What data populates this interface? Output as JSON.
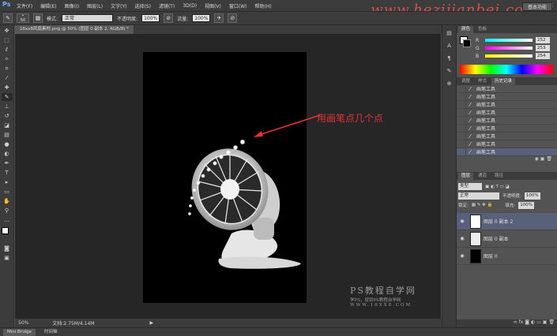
{
  "app": {
    "logo": "Ps"
  },
  "menu": [
    "文件(F)",
    "编辑(E)",
    "图像(I)",
    "图层(L)",
    "文字(Y)",
    "选择(S)",
    "滤镜(T)",
    "3D(D)",
    "视图(V)",
    "窗口(W)",
    "帮助(H)"
  ],
  "watermark": "www.hezijianbei.com",
  "options": {
    "brush_size": "50",
    "mode_label": "模式:",
    "mode_value": "正常",
    "opacity_label": "不透明度:",
    "opacity_value": "100%",
    "flow_label": "流量:",
    "flow_value": "100%",
    "workspace": "基本功能"
  },
  "document": {
    "tab_title": "16xx8风扇素材.png @ 50% (图层 0 副本 2, RGB/8) *",
    "zoom": "50%",
    "doc_size": "文档:2.75M/4.14M"
  },
  "annotation": {
    "text": "用画笔点几个点"
  },
  "ps_watermark": {
    "line1": "PS教程自学网",
    "line2": "学PS，就到PS教程自学网",
    "line3": "WWW.16XX8.COM"
  },
  "color_panel": {
    "tabs": [
      "颜色",
      "色板"
    ],
    "channels": [
      {
        "name": "R",
        "value": "252"
      },
      {
        "name": "G",
        "value": "253"
      },
      {
        "name": "B",
        "value": "254"
      }
    ]
  },
  "history_panel": {
    "tabs": [
      "调整",
      "样式",
      "历史记录"
    ],
    "items": [
      "画笔工具",
      "画笔工具",
      "画笔工具",
      "画笔工具",
      "画笔工具",
      "画笔工具",
      "画笔工具",
      "画笔工具",
      "画笔工具"
    ]
  },
  "layers_panel": {
    "tabs": [
      "图层",
      "通道",
      "路径"
    ],
    "kind_label": "类型",
    "blend": "正常",
    "opacity_label": "不透明度:",
    "opacity_value": "100%",
    "lock_label": "锁定:",
    "fill_label": "填充:",
    "fill_value": "100%",
    "layers": [
      {
        "name": "图层 0 副本 2",
        "selected": true
      },
      {
        "name": "图层 0 副本",
        "selected": false
      },
      {
        "name": "图层 0",
        "selected": false
      }
    ]
  },
  "bottom_tabs": [
    "Mini Bridge",
    "时间轴"
  ],
  "colors": {
    "annotation_red": "#e0323a",
    "selection_blue": "#596079",
    "panel_bg": "#535353",
    "bar_bg": "#3c3c3c"
  }
}
